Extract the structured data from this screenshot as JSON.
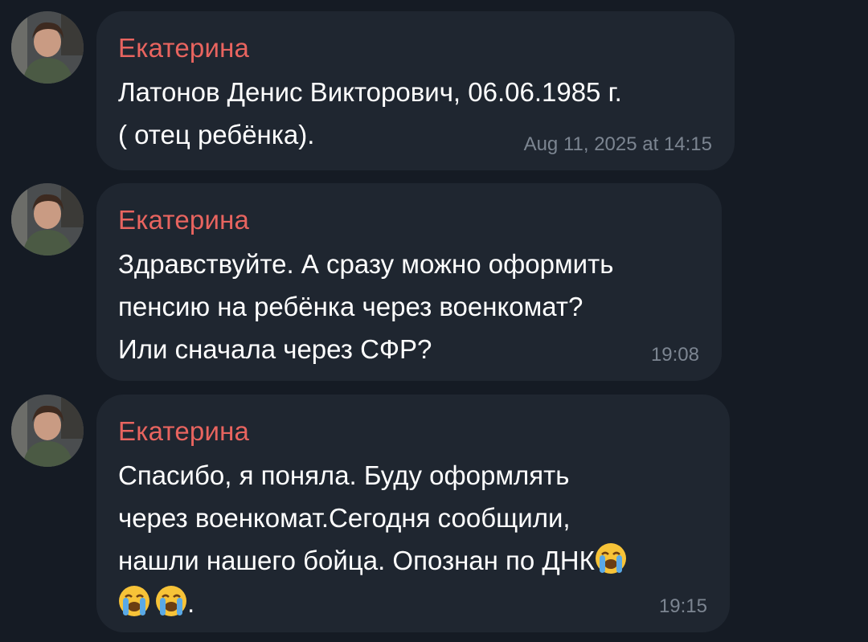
{
  "messages": [
    {
      "sender": "Екатерина",
      "text": "Латонов Денис Викторович, 06.06.1985 г.\n( отец ребёнка).",
      "time": "Aug 11, 2025 at 14:15"
    },
    {
      "sender": "Екатерина",
      "text": "Здравствуйте. А сразу можно оформить\nпенсию на ребёнка через военкомат?\nИли сначала через СФР?",
      "time": "19:08"
    },
    {
      "sender": "Екатерина",
      "text_before_emoji": "Спасибо, я поняла. Буду оформлять\nчерез военкомат.Сегодня сообщили,\nнашли нашего бойца. Опознан по ДНК",
      "text_after_emoji": ".",
      "emojis": [
        "loudly-crying-face",
        "loudly-crying-face",
        "loudly-crying-face"
      ],
      "time": "19:15"
    }
  ],
  "colors": {
    "background": "#151b24",
    "bubble": "#1f2630",
    "sender_name": "#e8645f",
    "message_text": "#ffffff",
    "timestamp": "#7c8591"
  }
}
